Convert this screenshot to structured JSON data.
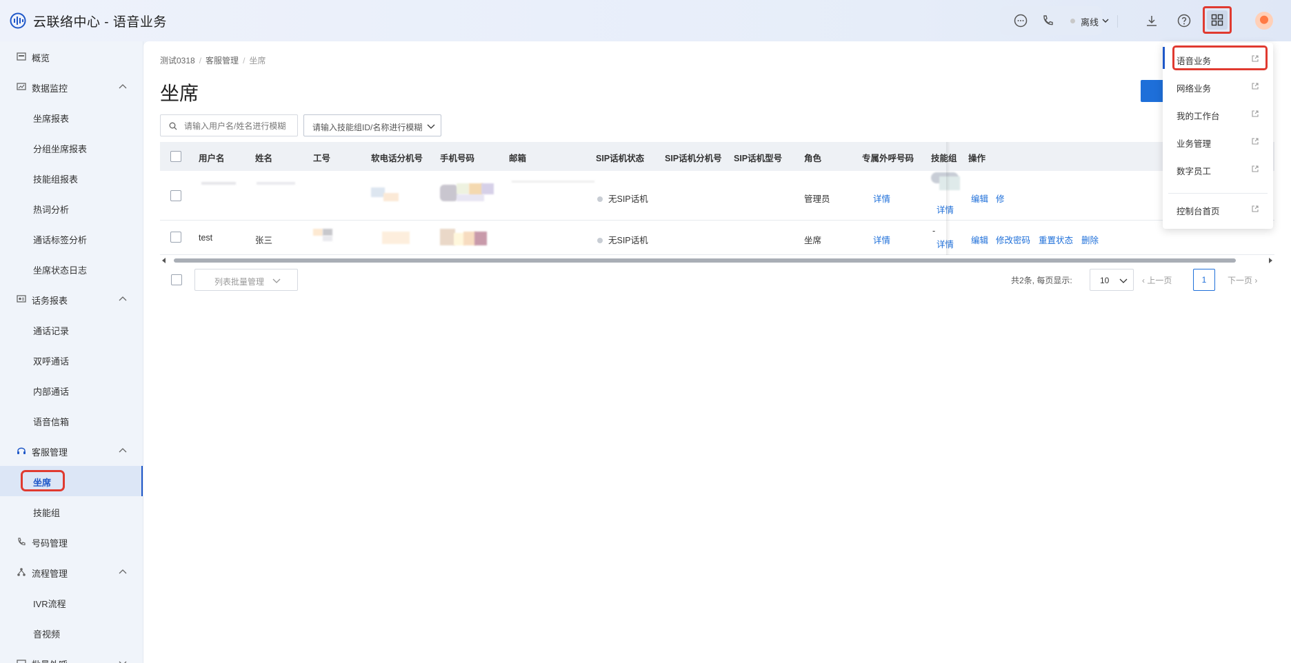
{
  "header": {
    "title": "云联络中心 - 语音业务",
    "status_label": "离线",
    "icons": [
      "audio-logo-icon",
      "chat-icon",
      "phone-icon",
      "download-icon",
      "help-icon",
      "grid-apps-icon"
    ]
  },
  "sidebar": {
    "items": [
      {
        "label": "概览",
        "type": "top",
        "icon": "overview-icon"
      },
      {
        "label": "数据监控",
        "type": "group",
        "icon": "monitor-icon"
      },
      {
        "label": "坐席报表",
        "type": "sub"
      },
      {
        "label": "分组坐席报表",
        "type": "sub"
      },
      {
        "label": "技能组报表",
        "type": "sub"
      },
      {
        "label": "热词分析",
        "type": "sub"
      },
      {
        "label": "通话标签分析",
        "type": "sub"
      },
      {
        "label": "坐席状态日志",
        "type": "sub"
      },
      {
        "label": "话务报表",
        "type": "group",
        "icon": "report-icon"
      },
      {
        "label": "通话记录",
        "type": "sub"
      },
      {
        "label": "双呼通话",
        "type": "sub"
      },
      {
        "label": "内部通话",
        "type": "sub"
      },
      {
        "label": "语音信箱",
        "type": "sub"
      },
      {
        "label": "客服管理",
        "type": "group",
        "icon": "headset-icon"
      },
      {
        "label": "坐席",
        "type": "sub",
        "active": true
      },
      {
        "label": "技能组",
        "type": "sub"
      },
      {
        "label": "号码管理",
        "type": "top",
        "icon": "phone-number-icon"
      },
      {
        "label": "流程管理",
        "type": "group",
        "icon": "flow-icon"
      },
      {
        "label": "IVR流程",
        "type": "sub"
      },
      {
        "label": "音视频",
        "type": "sub"
      },
      {
        "label": "批量外呼",
        "type": "group",
        "icon": "batch-call-icon"
      }
    ]
  },
  "breadcrumb": [
    "测试0318",
    "客服管理",
    "坐席"
  ],
  "page_title": "坐席",
  "search": {
    "placeholder": "请输入用户名/姓名进行模糊",
    "value": ""
  },
  "skill_filter": {
    "placeholder": "请输入技能组ID/名称进行模糊"
  },
  "table": {
    "columns": [
      "用户名",
      "姓名",
      "工号",
      "软电话分机号",
      "手机号码",
      "邮箱",
      "SIP话机状态",
      "SIP话机分机号",
      "SIP话机型号",
      "角色",
      "专属外呼号码",
      "技能组",
      "操作"
    ],
    "rows": [
      {
        "username": "",
        "name": "",
        "sip_status": "无SIP话机",
        "role": "管理员",
        "outbound_link": "详情",
        "skill_group": "",
        "skill_link": "详情",
        "ops": [
          "编辑",
          "修"
        ]
      },
      {
        "username": "test",
        "name": "张三",
        "sip_status": "无SIP话机",
        "role": "坐席",
        "outbound_link": "详情",
        "skill_group": "-",
        "skill_link": "详情",
        "ops": [
          "编辑",
          "修改密码",
          "重置状态",
          "删除"
        ]
      }
    ]
  },
  "batch": {
    "label": "列表批量管理"
  },
  "pagination": {
    "total_text": "共2条, 每页显示:",
    "page_size": "10",
    "prev": "上一页",
    "current_page": "1",
    "next": "下一页"
  },
  "dropdown": {
    "items": [
      "语音业务",
      "网络业务",
      "我的工作台",
      "业务管理",
      "数字员工",
      "控制台首页"
    ]
  },
  "colors": {
    "accent": "#1e6fd9",
    "highlight": "#e03a30",
    "sidebar_active": "#1e57c8"
  }
}
